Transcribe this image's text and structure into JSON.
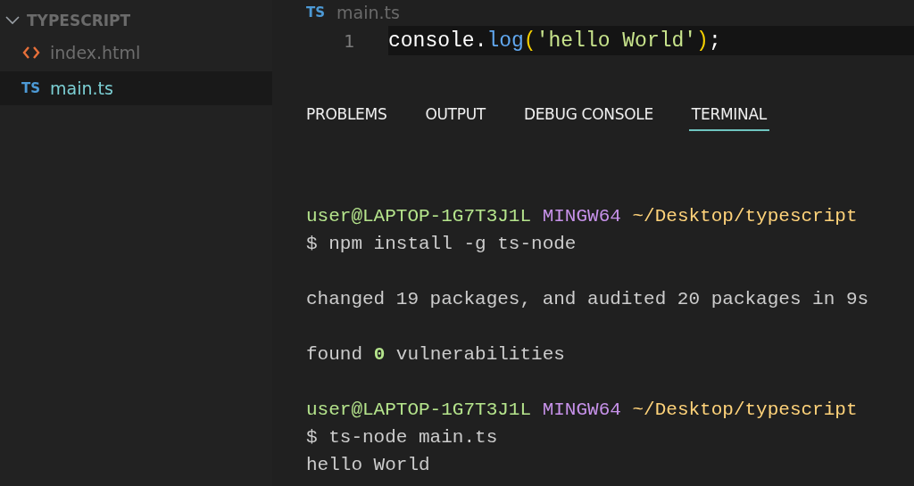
{
  "sidebar": {
    "folder": {
      "label": "TYPESCRIPT",
      "expanded": true
    },
    "items": [
      {
        "name": "index.html",
        "kind": "html",
        "selected": false
      },
      {
        "name": "main.ts",
        "kind": "ts",
        "icon_text": "TS",
        "selected": true
      }
    ]
  },
  "editor": {
    "tab": {
      "icon_text": "TS",
      "label": "main.ts"
    },
    "lines": [
      {
        "number": "1",
        "tokens": [
          {
            "text": "console",
            "kind": "plain"
          },
          {
            "text": ".",
            "kind": "plain"
          },
          {
            "text": "log",
            "kind": "method"
          },
          {
            "text": "(",
            "kind": "bracket"
          },
          {
            "text": "'hello World'",
            "kind": "string"
          },
          {
            "text": ")",
            "kind": "bracket"
          },
          {
            "text": ";",
            "kind": "plain"
          }
        ]
      }
    ]
  },
  "panel": {
    "tabs": [
      {
        "label": "PROBLEMS",
        "selected": false
      },
      {
        "label": "OUTPUT",
        "selected": false
      },
      {
        "label": "DEBUG CONSOLE",
        "selected": false
      },
      {
        "label": "TERMINAL",
        "selected": true
      }
    ],
    "terminal": {
      "blocks": [
        [
          [
            {
              "text": "user@LAPTOP-1G7T3J1L",
              "kind": "user"
            },
            {
              "text": "MINGW64",
              "kind": "host"
            },
            {
              "text": "~/Desktop/typescript",
              "kind": "path"
            }
          ],
          [
            {
              "text": "$ npm install -g ts-node",
              "kind": "plain"
            }
          ]
        ],
        [
          [
            {
              "text": "changed 19 packages, and audited 20 packages in 9s",
              "kind": "plain"
            }
          ]
        ],
        [
          [
            {
              "text": "found",
              "kind": "plain"
            },
            {
              "text": "0",
              "kind": "count"
            },
            {
              "text": "vulnerabilities",
              "kind": "plain"
            }
          ]
        ],
        [
          [
            {
              "text": "user@LAPTOP-1G7T3J1L",
              "kind": "user"
            },
            {
              "text": "MINGW64",
              "kind": "host"
            },
            {
              "text": "~/Desktop/typescript",
              "kind": "path"
            }
          ],
          [
            {
              "text": "$ ts-node main.ts",
              "kind": "plain"
            }
          ],
          [
            {
              "text": "hello World",
              "kind": "plain"
            }
          ]
        ]
      ]
    }
  }
}
